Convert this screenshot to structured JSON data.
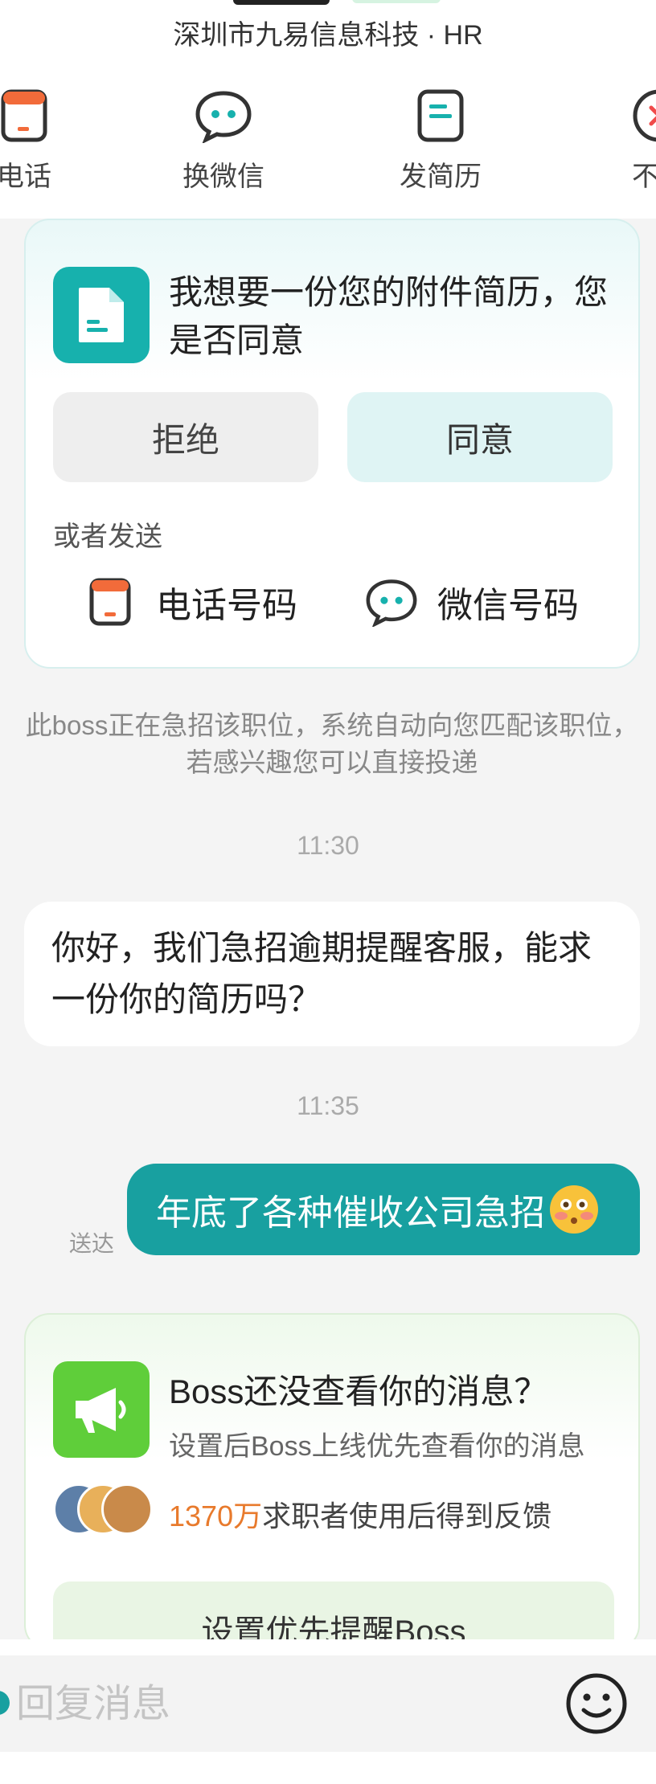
{
  "header": {
    "company": "深圳市九易信息科技 · HR",
    "actions": [
      {
        "label": "电话",
        "icon": "phone-icon"
      },
      {
        "label": "换微信",
        "icon": "wechat-icon"
      },
      {
        "label": "发简历",
        "icon": "resume-icon"
      },
      {
        "label": "不感",
        "icon": "not-interested-icon"
      }
    ]
  },
  "resume_request": {
    "title": "我想要一份您的附件简历，您是否同意",
    "reject_label": "拒绝",
    "agree_label": "同意",
    "alt_label": "或者发送",
    "phone_label": "电话号码",
    "wechat_label": "微信号码"
  },
  "system_note": "此boss正在急招该职位，系统自动向您匹配该职位，若感兴趣您可以直接投递",
  "messages": [
    {
      "time": "11:30",
      "direction": "in",
      "text": "你好，我们急招逾期提醒客服，能求一份你的简历吗？"
    },
    {
      "time": "11:35",
      "direction": "out",
      "text": "年底了各种催收公司急招",
      "emoji": "flushed-face-emoji",
      "status": "送达"
    }
  ],
  "boss_reminder": {
    "title": "Boss还没查看你的消息？",
    "subtitle": "设置后Boss上线优先查看你的消息",
    "count": "1370万",
    "feedback_text": "求职者使用后得到反馈",
    "button_label": "设置优先提醒Boss"
  },
  "input": {
    "placeholder": "回复消息"
  },
  "colors": {
    "teal": "#18a0a0",
    "green": "#5fce3a",
    "orange": "#e87a2c"
  }
}
